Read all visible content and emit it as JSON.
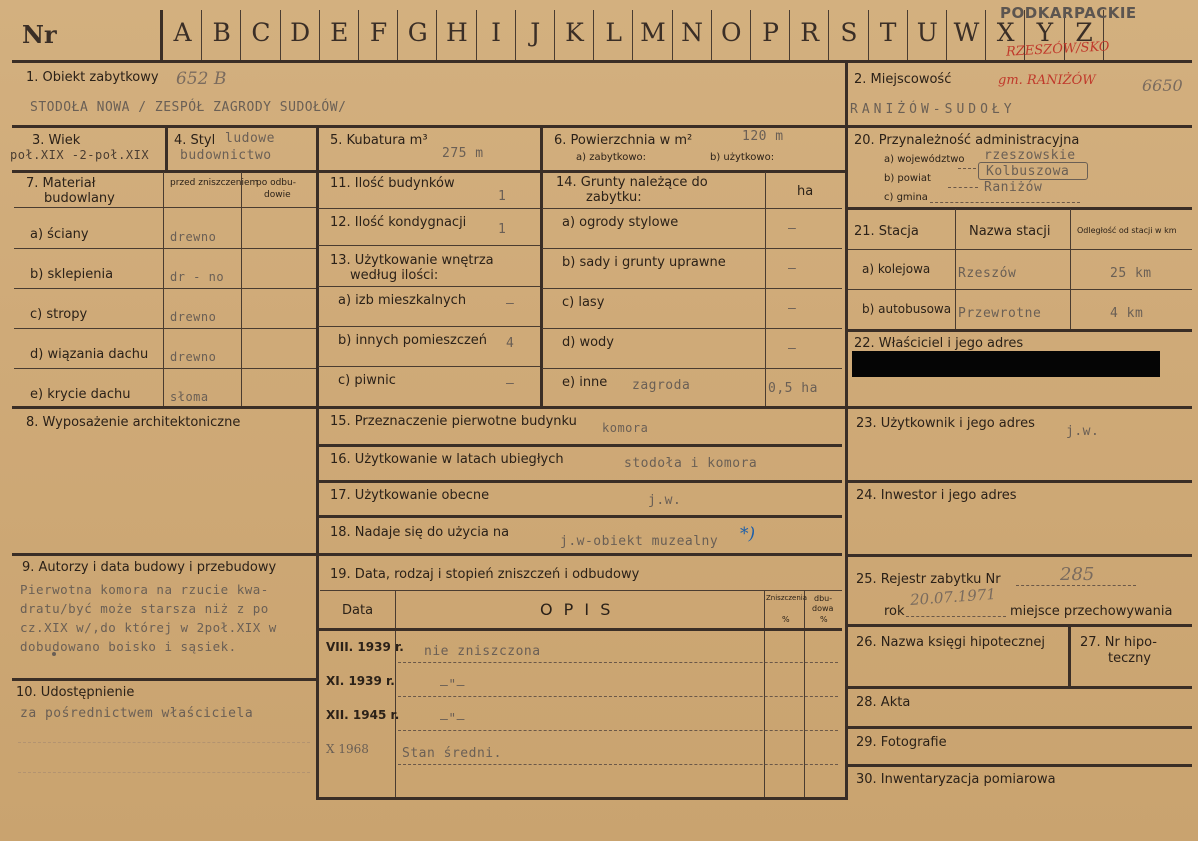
{
  "header": {
    "nr_label": "Nr",
    "letters": [
      "A",
      "B",
      "C",
      "D",
      "E",
      "F",
      "G",
      "H",
      "I",
      "J",
      "K",
      "L",
      "M",
      "N",
      "O",
      "P",
      "R",
      "S",
      "T",
      "U",
      "W",
      "X",
      "Y",
      "Z"
    ],
    "stamp_region": "PODKARPACKIE",
    "stamp_city": "RZESZÓW/SKO"
  },
  "f1": {
    "label": "1. Obiekt zabytkowy",
    "number": "652 B",
    "value": "STODOŁA NOWA / ZESPÓŁ ZAGRODY SUDOŁÓW/"
  },
  "f2": {
    "label": "2. Miejscowość",
    "gmina": "gm. RANIŻÓW",
    "code": "6650",
    "value": "RANIŻÓW-SUDOŁY"
  },
  "f3": {
    "label": "3. Wiek",
    "value": "poł.XIX -2-poł.XIX"
  },
  "f4": {
    "label": "4. Styl",
    "value_1": "ludowe",
    "value_2": "budownictwo"
  },
  "f5": {
    "label": "5. Kubatura m³",
    "value": "275 m"
  },
  "f6": {
    "label": "6. Powierzchnia w m²",
    "sub_a": "a) zabytkowo:",
    "sub_b": "b) użytkowo:",
    "value": "120 m"
  },
  "f20": {
    "label": "20. Przynależność administracyjna",
    "a": "a) województwo",
    "b": "b) powiat",
    "c": "c) gmina",
    "a_val": "rzeszowskie",
    "b_val": "Kolbuszowa",
    "c_val": "Raniżów"
  },
  "f7": {
    "label_1": "7. Materiał",
    "label_2": "budowlany",
    "col_before_1": "przed zniszczeniem",
    "col_before_2": "czeniem",
    "col_after_1": "po odbu-",
    "col_after_2": "dowie",
    "rows": [
      {
        "label": "a) ściany",
        "before": "drewno"
      },
      {
        "label": "b) sklepienia",
        "before": "dr - no"
      },
      {
        "label": "c) stropy",
        "before": "drewno"
      },
      {
        "label": "d) wiązania dachu",
        "before": "drewno"
      },
      {
        "label": "e) krycie dachu",
        "before": "słoma"
      }
    ]
  },
  "f11": {
    "label": "11. Ilość budynków",
    "value": "1"
  },
  "f12": {
    "label": "12. Ilość kondygnacji",
    "value": "1"
  },
  "f13": {
    "label_1": "13. Użytkowanie wnętrza",
    "label_2": "według ilości:",
    "rows": [
      {
        "label": "a) izb mieszkalnych",
        "value": "–"
      },
      {
        "label": "b) innych pomieszczeń",
        "value": "4"
      },
      {
        "label": "c) piwnic",
        "value": "–"
      }
    ]
  },
  "f14": {
    "label_1": "14. Grunty należące do",
    "label_2": "zabytku:",
    "unit": "ha",
    "rows": [
      {
        "label": "a) ogrody stylowe",
        "value": "–"
      },
      {
        "label": "b) sady i grunty uprawne",
        "value": "–"
      },
      {
        "label": "c) lasy",
        "value": "–"
      },
      {
        "label": "d) wody",
        "value": "–"
      },
      {
        "label": "e) inne",
        "note": "zagroda",
        "value": "0,5 ha"
      }
    ]
  },
  "f21": {
    "label": "21. Stacja",
    "col_name": "Nazwa stacji",
    "col_dist": "Odległość od stacji w km",
    "rows": [
      {
        "label": "a) kolejowa",
        "name": "Rzeszów",
        "dist": "25 km"
      },
      {
        "label": "b) autobusowa",
        "name": "Przewrotne",
        "dist": "4 km"
      }
    ]
  },
  "f22": {
    "label": "22. Właściciel i jego adres"
  },
  "f8": {
    "label": "8. Wyposażenie architektoniczne"
  },
  "f15": {
    "label": "15. Przeznaczenie pierwotne budynku",
    "value": "komora"
  },
  "f16": {
    "label": "16. Użytkowanie w latach ubiegłych",
    "value": "stodoła i komora"
  },
  "f17": {
    "label": "17. Użytkowanie obecne",
    "value": "j.w."
  },
  "f18": {
    "label": "18. Nadaje się do użycia na",
    "value": "j.w-obiekt muzealny",
    "mark": "*)"
  },
  "f19": {
    "label": "19. Data, rodzaj i stopień zniszczeń i odbudowy",
    "col_date": "Data",
    "col_opis": "O P I S",
    "col_zn_1": "Zniszczenia",
    "col_zn_2": "%",
    "col_odb_1": "dbu-",
    "col_odb_2": "dowa",
    "col_odb_3": "%",
    "rows": [
      {
        "date": "VIII. 1939 r.",
        "opis": "nie zniszczona"
      },
      {
        "date": "XI. 1939 r.",
        "opis": "–\"–"
      },
      {
        "date": "XII. 1945 r.",
        "opis": "–\"–"
      },
      {
        "date": "X 1968",
        "opis": "Stan średni."
      }
    ]
  },
  "f23": {
    "label": "23. Użytkownik i jego adres",
    "value": "j.w."
  },
  "f24": {
    "label": "24. Inwestor i jego adres"
  },
  "f9": {
    "label": "9. Autorzy i data budowy i przebudowy",
    "lines": [
      "Pierwotna komora na rzucie kwa-",
      "dratu/być może starsza niż z po",
      "cz.XIX w/,do której w 2poł.XIX w",
      "dobudowano boisko i sąsiek."
    ]
  },
  "f25": {
    "label": "25. Rejestr zabytku Nr",
    "number": "285",
    "rok_label": "rok",
    "rok": "20.07.1971",
    "miejsce": "miejsce przechowywania"
  },
  "f26": {
    "label": "26. Nazwa księgi hipotecznej"
  },
  "f27": {
    "label_1": "27. Nr hipo-",
    "label_2": "teczny"
  },
  "f10": {
    "label": "10. Udostępnienie",
    "value": "za pośrednictwem właściciela"
  },
  "f28": {
    "label": "28. Akta"
  },
  "f29": {
    "label": "29. Fotografie"
  },
  "f30": {
    "label": "30. Inwentaryzacja pomiarowa"
  }
}
